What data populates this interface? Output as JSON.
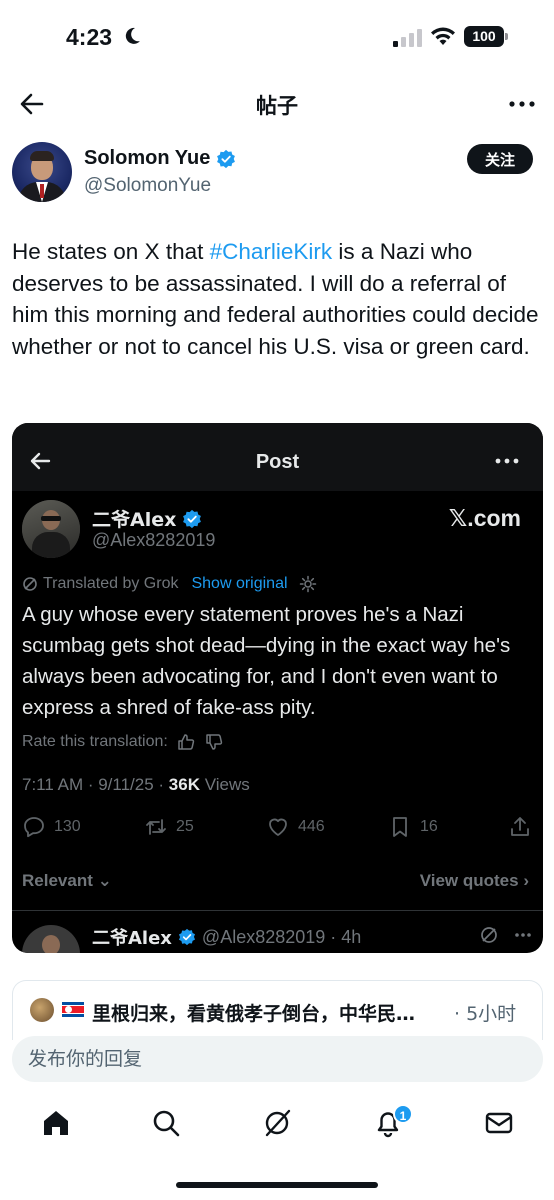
{
  "status_bar": {
    "time": "4:23",
    "battery": "100"
  },
  "nav": {
    "title": "帖子"
  },
  "author": {
    "name": "Solomon Yue",
    "handle": "@SolomonYue",
    "follow_label": "关注"
  },
  "tweet": {
    "before_hashtag": "He states on X that ",
    "hashtag": "#CharlieKirk",
    "after_hashtag": " is a Nazi who deserves to be assassinated. I will do a referral of him this morning and federal authorities could decide whether or not to cancel his U.S. visa or green card."
  },
  "embed": {
    "nav_title": "Post",
    "author_name": "二爷Alex",
    "author_handle": "@Alex8282019",
    "watermark": "𝕏.com",
    "translated_label": "Translated by Grok",
    "show_original": "Show original",
    "body": "A guy whose every statement proves he's a Nazi scumbag gets shot dead—dying in the exact way he's always been advocating for, and I don't even want to express a shred of fake-ass pity.",
    "rate_label": "Rate this translation:",
    "timestamp": "7:11 AM · 9/11/25 · ",
    "views_count": "36K",
    "views_label": " Views",
    "actions": {
      "replies": "130",
      "reposts": "25",
      "likes": "446",
      "bookmarks": "16"
    },
    "relevant_label": "Relevant",
    "view_quotes_label": "View quotes",
    "reply": {
      "name": "二爷Alex",
      "handle_time": "@Alex8282019 · 4h"
    }
  },
  "reply_preview": {
    "text": "里根归来，看黄俄孝子倒台，中华民…",
    "time": "· 5小时"
  },
  "composer": {
    "placeholder": "发布你的回复"
  },
  "tabbar": {
    "notification_count": "1"
  },
  "colors": {
    "accent": "#1d9bf0",
    "text": "#0f1419",
    "muted": "#536471"
  }
}
